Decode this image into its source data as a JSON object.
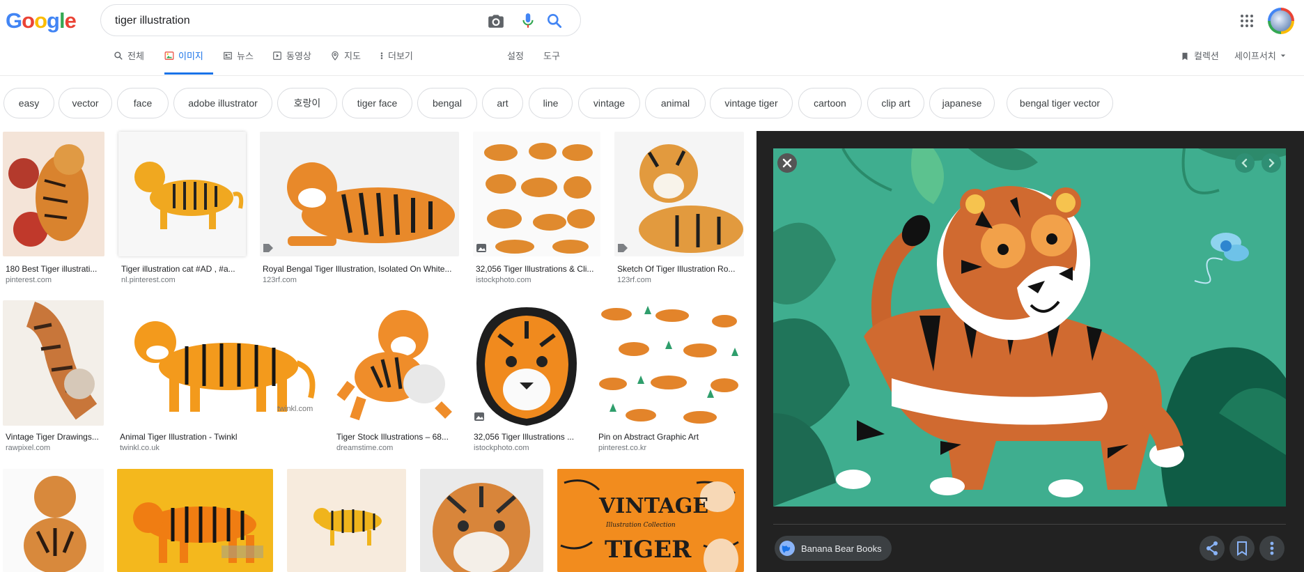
{
  "header": {
    "logo": [
      "G",
      "o",
      "o",
      "g",
      "l",
      "e"
    ],
    "logo_colors": [
      "#4285f4",
      "#ea4335",
      "#fbbc05",
      "#4285f4",
      "#34a853",
      "#ea4335"
    ],
    "search_value": "tiger illustration",
    "icons": [
      "camera-icon",
      "microphone-icon",
      "search-icon",
      "apps-icon",
      "avatar"
    ]
  },
  "tabs": [
    {
      "label": "전체",
      "icon": "search-icon"
    },
    {
      "label": "이미지",
      "icon": "image-icon",
      "active": true
    },
    {
      "label": "뉴스",
      "icon": "news-icon"
    },
    {
      "label": "동영상",
      "icon": "video-icon"
    },
    {
      "label": "지도",
      "icon": "map-pin-icon"
    },
    {
      "label": "더보기",
      "icon": "more-vert-icon"
    },
    {
      "label": "설정"
    },
    {
      "label": "도구"
    }
  ],
  "right_links": {
    "collections": "컬렉션",
    "safesearch": "세이프서치"
  },
  "chips": [
    "easy",
    "vector",
    "face",
    "adobe illustrator",
    "호랑이",
    "tiger face",
    "bengal",
    "art",
    "line",
    "vintage",
    "animal",
    "vintage tiger",
    "cartoon",
    "clip art",
    "japanese",
    "bengal tiger vector"
  ],
  "results": [
    {
      "caption": "180 Best Tiger illustrati...",
      "source": "pinterest.com"
    },
    {
      "caption": "Tiger illustration cat #AD , #a...",
      "source": "nl.pinterest.com"
    },
    {
      "caption": "Royal Bengal Tiger Illustration, Isolated On White...",
      "source": "123rf.com"
    },
    {
      "caption": "32,056 Tiger Illustrations & Cli...",
      "source": "istockphoto.com"
    },
    {
      "caption": "Sketch Of Tiger Illustration Ro...",
      "source": "123rf.com"
    },
    {
      "caption": "Vintage Tiger Drawings...",
      "source": "rawpixel.com"
    },
    {
      "caption": "Animal Tiger Illustration - Twinkl",
      "source": "twinkl.co.uk"
    },
    {
      "caption": "Tiger Stock Illustrations – 68...",
      "source": "dreamstime.com"
    },
    {
      "caption": "32,056 Tiger Illustrations ...",
      "source": "istockphoto.com"
    },
    {
      "caption": "Pin on Abstract Graphic Art",
      "source": "pinterest.co.kr"
    }
  ],
  "thumb_text": {
    "twinkl": "twinkl.com",
    "vintage": "VINTAGE",
    "vintage_sub": "Illustration Collection",
    "tiger": "TIGER"
  },
  "preview": {
    "source": "Banana Bear Books",
    "buttons": [
      "close-icon",
      "prev-icon",
      "next-icon",
      "share-icon",
      "bookmark-icon",
      "more-vert-icon"
    ]
  },
  "colors": {
    "accent": "#1a73e8",
    "panel": "#222222",
    "preview_bg": "#3fae8f"
  }
}
